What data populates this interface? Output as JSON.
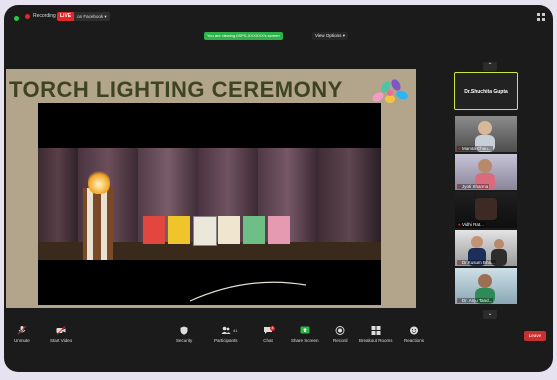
{
  "topbar": {
    "recording_label": "Recording",
    "live_badge": "LIVE",
    "live_target": "on Facebook",
    "viewing_text": "You are viewing IISPS-XXXXXX's screen",
    "view_options": "View Options"
  },
  "slide": {
    "title": "TORCH LIGHTING CEREMONY"
  },
  "participants_panel": {
    "active_speaker": "Dr.Shuchita Gupta",
    "tiles": [
      {
        "name": "Mamta Chou..."
      },
      {
        "name": "Jyoti Sharma"
      },
      {
        "name": "Vidhi Rat..."
      },
      {
        "name": "Dr.Kusum Bha..."
      },
      {
        "name": "Dr. Anju Tand..."
      }
    ]
  },
  "toolbar": {
    "unmute": "Unmute",
    "start_video": "Start Video",
    "security": "Security",
    "participants": "Participants",
    "participants_count": "41",
    "chat": "Chat",
    "chat_badge": "4",
    "share_screen": "Share Screen",
    "record": "Record",
    "breakout": "Breakout Rooms",
    "reactions": "Reactions",
    "leave": "Leave"
  },
  "colors": {
    "accent_green": "#2db34a",
    "leave_red": "#c93030",
    "speaker_border": "#cfe63a"
  }
}
